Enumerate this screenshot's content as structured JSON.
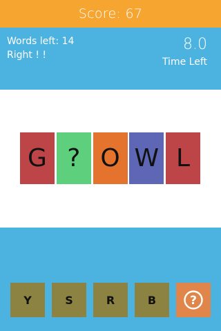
{
  "header": {
    "score_label": "Score:",
    "score_value": "67",
    "bg_color": "#F6A531"
  },
  "info": {
    "words_left_label": "Words left:",
    "words_left_value": "14",
    "status": "Right ! !",
    "time_value": "8.0",
    "time_label": "Time Left",
    "bg_color": "#4CB2DF"
  },
  "word": {
    "tiles": [
      {
        "letter": "G",
        "color": "#BE4547"
      },
      {
        "letter": "?",
        "color": "#5ED07D"
      },
      {
        "letter": "O",
        "color": "#E3732D"
      },
      {
        "letter": "W",
        "color": "#5E67B6"
      },
      {
        "letter": "L",
        "color": "#BE4547"
      }
    ]
  },
  "choices": {
    "letters": [
      "Y",
      "S",
      "R",
      "B"
    ],
    "button_color": "#8C8242",
    "hint_icon": "question-circle-icon",
    "hint_color": "#E1864A"
  }
}
